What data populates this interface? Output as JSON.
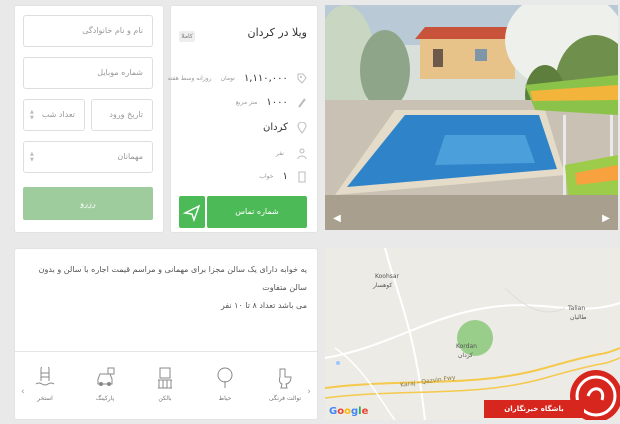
{
  "listing": {
    "title": "ویلا در کردان",
    "tag": "کاملا",
    "price": "۱,۱۱۰,۰۰۰",
    "price_unit": "تومان",
    "price_period": "روزانه   وسط هفته",
    "area": "۱۰۰۰",
    "area_unit": "متر مربع",
    "city": "کردان",
    "capacity_unit": "نفر",
    "bedrooms": "۱",
    "bedrooms_unit": "خواب",
    "call_label": "شماره تماس"
  },
  "form": {
    "name_placeholder": "نام و نام خانوادگی",
    "mobile_placeholder": "شماره موبایل",
    "checkin_placeholder": "تاریخ ورود",
    "nights_placeholder": "تعداد شب",
    "guests_label": "مهمانان",
    "reserve_label": "رزرو"
  },
  "description": {
    "line1": "یه خوابه دارای یک سالن مجزا برای مهمانی و مراسم قیمت اجاره با سالن و بدون سالن متفاوت",
    "line2": "می باشد تعداد ۸ تا ۱۰ نفر"
  },
  "amenities": [
    {
      "label": "توالت فرنگی",
      "icon": "toilet-icon"
    },
    {
      "label": "حیاط",
      "icon": "tree-icon"
    },
    {
      "label": "بالکن",
      "icon": "balcony-icon"
    },
    {
      "label": "پارکینگ",
      "icon": "parking-icon"
    },
    {
      "label": "استخر",
      "icon": "pool-icon"
    }
  ],
  "map": {
    "koohsar_en": "Koohsar",
    "koohsar_fa": "کوهسار",
    "kordan_en": "Kordan",
    "kordan_fa": "کردان",
    "talian_en": "Talian",
    "talian_fa": "طالیان",
    "road_label": "Karaj - Qazvin Fwy",
    "google": [
      "G",
      "o",
      "o",
      "g",
      "l",
      "e"
    ]
  },
  "badge": {
    "text": "باشگاه خبرنگاران"
  },
  "colors": {
    "primary_green": "#4cbb57",
    "reserve_green": "#9fcc9c",
    "badge_red": "#d7261e"
  }
}
